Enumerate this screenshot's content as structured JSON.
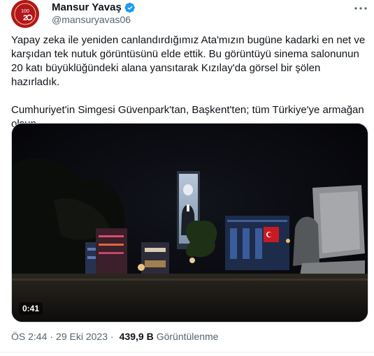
{
  "author": {
    "name": "Mansur Yavaş",
    "handle": "@mansuryavas06",
    "avatar_text": "100",
    "verified": true
  },
  "tweet": {
    "paragraph1": "Yapay zeka ile yeniden canlandırdığımız Ata'mızın bugüne kadarki en net ve karşıdan tek nutuk görüntüsünü elde ettik. Bu görüntüyü sinema salonunun 20 katı büyüklüğündeki alana yansıtarak Kızılay'da görsel bir şölen hazırladık.",
    "paragraph2": "Cumhuriyet'in Simgesi Güvenpark'tan, Başkent'ten; tüm Türkiye'ye armağan olsun.",
    "flag_emoji": "turkey-flag"
  },
  "media": {
    "duration": "0:41"
  },
  "meta": {
    "time": "ÖS 2:44",
    "separator": "·",
    "date": "29 Eki 2023",
    "views_count": "439,9 B",
    "views_label": "Görüntülenme"
  },
  "colors": {
    "text": "#0f1419",
    "secondary": "#536471",
    "verified": "#1d9bf0",
    "flag_red": "#e30a17"
  }
}
